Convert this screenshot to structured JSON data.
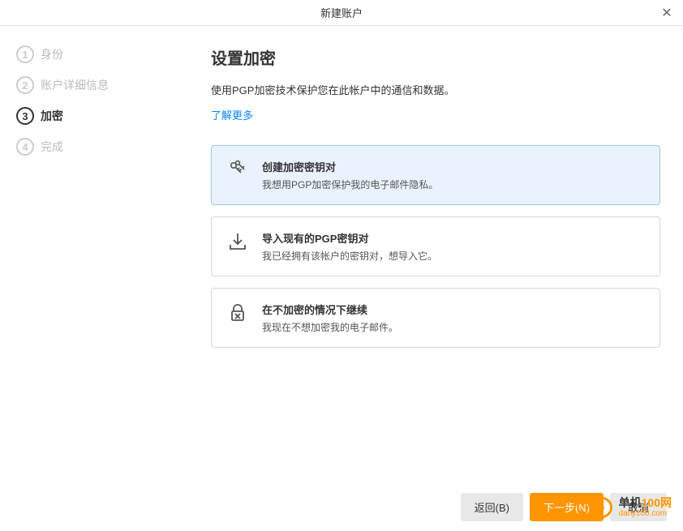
{
  "window": {
    "title": "新建账户"
  },
  "steps": [
    {
      "num": "1",
      "label": "身份"
    },
    {
      "num": "2",
      "label": "账户详细信息"
    },
    {
      "num": "3",
      "label": "加密"
    },
    {
      "num": "4",
      "label": "完成"
    }
  ],
  "content": {
    "title": "设置加密",
    "description": "使用PGP加密技术保护您在此帐户中的通信和数据。",
    "learn_more": "了解更多"
  },
  "options": [
    {
      "title": "创建加密密钥对",
      "desc": "我想用PGP加密保护我的电子邮件隐私。"
    },
    {
      "title": "导入现有的PGP密钥对",
      "desc": "我已经拥有该帐户的密钥对，想导入它。"
    },
    {
      "title": "在不加密的情况下继续",
      "desc": "我现在不想加密我的电子邮件。"
    }
  ],
  "footer": {
    "back": "返回(B)",
    "next": "下一步(N)",
    "cancel": "取消"
  },
  "watermark": {
    "line1a": "单机",
    "line1b": "100网",
    "line2": "danji100.com"
  }
}
